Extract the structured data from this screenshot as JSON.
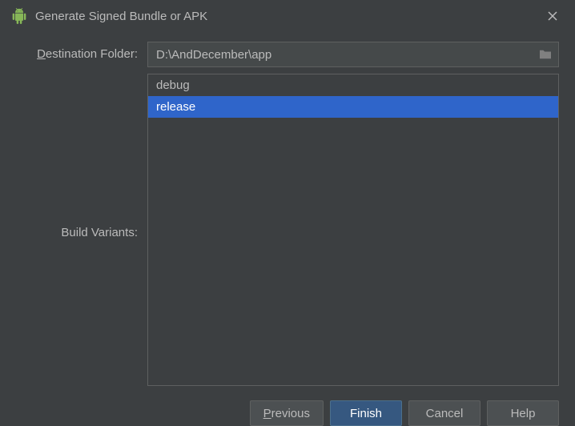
{
  "window": {
    "title": "Generate Signed Bundle or APK"
  },
  "form": {
    "destination": {
      "label_prefix": "D",
      "label_rest": "estination Folder:",
      "value": "D:\\AndDecember\\app"
    },
    "variants": {
      "label_prefix": "B",
      "label_rest": "uild Variants:",
      "items": [
        {
          "label": "debug",
          "selected": false
        },
        {
          "label": "release",
          "selected": true
        }
      ]
    }
  },
  "buttons": {
    "previous": "Previous",
    "finish": "Finish",
    "cancel": "Cancel",
    "help": "Help"
  }
}
